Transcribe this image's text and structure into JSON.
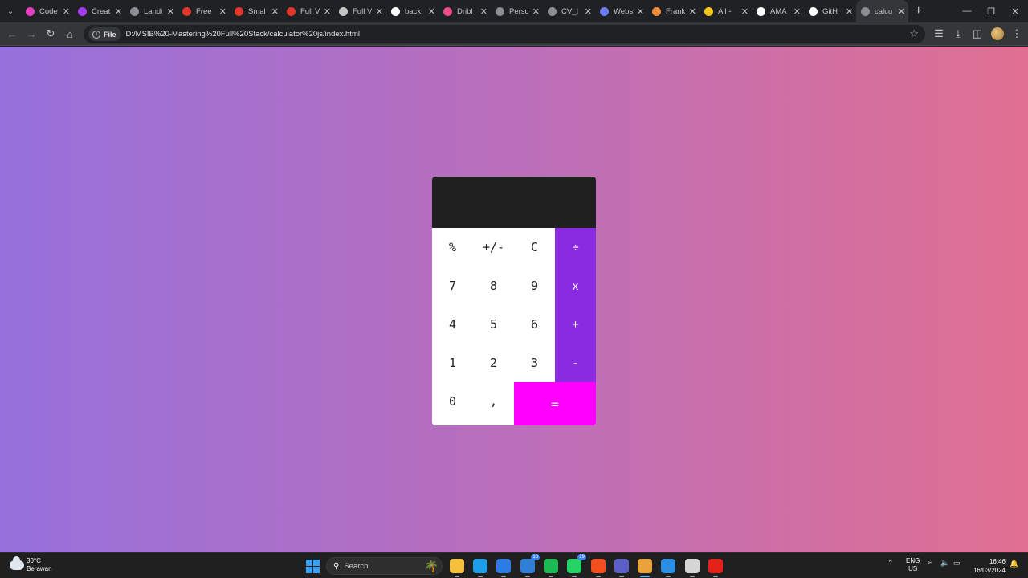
{
  "browser": {
    "tabs": [
      {
        "label": "Code",
        "icon": "codepen-pink-icon",
        "color": "#e53ebf"
      },
      {
        "label": "Creat",
        "icon": "messenger-icon",
        "color": "#a23cf2"
      },
      {
        "label": "Landi",
        "icon": "globe-icon",
        "color": "#8a8d91"
      },
      {
        "label": "Free",
        "icon": "s-logo-icon",
        "color": "#e0362c"
      },
      {
        "label": "Smal",
        "icon": "s-logo-icon",
        "color": "#e0362c"
      },
      {
        "label": "Full V",
        "icon": "s-logo-icon",
        "color": "#e0362c"
      },
      {
        "label": "Full V",
        "icon": "world-icon",
        "color": "#c4c7c5"
      },
      {
        "label": "back",
        "icon": "google-icon",
        "color": "#ffffff"
      },
      {
        "label": "Dribl",
        "icon": "dribbble-icon",
        "color": "#ea4c89"
      },
      {
        "label": "Perso",
        "icon": "globe-icon",
        "color": "#8a8d91"
      },
      {
        "label": "CV_I",
        "icon": "globe-icon",
        "color": "#8a8d91"
      },
      {
        "label": "Webs",
        "icon": "webflow-icon",
        "color": "#6c7cf0"
      },
      {
        "label": "Frank",
        "icon": "frank-icon",
        "color": "#f08c3a"
      },
      {
        "label": "All -",
        "icon": "yellow-dot-icon",
        "color": "#f5c518"
      },
      {
        "label": "AMA",
        "icon": "ama-icon",
        "color": "#ffffff"
      },
      {
        "label": "GitH",
        "icon": "github-icon",
        "color": "#ffffff"
      },
      {
        "label": "calcu",
        "icon": "globe-icon",
        "color": "#8a8d91"
      }
    ],
    "active_tab_index": 16,
    "new_tab_label": "+",
    "address": {
      "chip": "File",
      "url": "D:/MSIB%20-Mastering%20Full%20Stack/calculator%20js/index.html"
    }
  },
  "calculator": {
    "display_value": "",
    "keys": {
      "percent": "%",
      "sign": "+/-",
      "clear": "C",
      "divide": "÷",
      "seven": "7",
      "eight": "8",
      "nine": "9",
      "multiply": "x",
      "four": "4",
      "five": "5",
      "six": "6",
      "add": "+",
      "one": "1",
      "two": "2",
      "three": "3",
      "subtract": "-",
      "zero": "0",
      "comma": ",",
      "equals": "="
    },
    "colors": {
      "display_bg": "#202020",
      "operator_bg": "#8a2be2",
      "equals_bg": "#ff00ff",
      "gradient_start": "#9670dc",
      "gradient_end": "#e06f91"
    }
  },
  "taskbar": {
    "weather": {
      "temp": "30°C",
      "condition": "Berawan"
    },
    "search_placeholder": "Search",
    "apps": [
      {
        "name": "file-explorer-icon",
        "color": "#f5c13d"
      },
      {
        "name": "edge-icon",
        "color": "#1f9ee8"
      },
      {
        "name": "store-icon",
        "color": "#2c7be5"
      },
      {
        "name": "mail-icon",
        "color": "#2f7fd6",
        "badge": "18"
      },
      {
        "name": "spotify-icon",
        "color": "#1db954"
      },
      {
        "name": "whatsapp-icon",
        "color": "#25d366",
        "badge": "29"
      },
      {
        "name": "figma-icon",
        "color": "#f24e1e"
      },
      {
        "name": "teams-icon",
        "color": "#5b5fc7"
      },
      {
        "name": "chrome-icon",
        "color": "#e8a33b"
      },
      {
        "name": "vscode-icon",
        "color": "#2a8fe0"
      },
      {
        "name": "media-player-icon",
        "color": "#d6d6d6"
      },
      {
        "name": "acrobat-icon",
        "color": "#e2231a"
      }
    ],
    "lang": {
      "line1": "ENG",
      "line2": "US"
    },
    "clock": {
      "time": "16:46",
      "date": "16/03/2024"
    }
  }
}
